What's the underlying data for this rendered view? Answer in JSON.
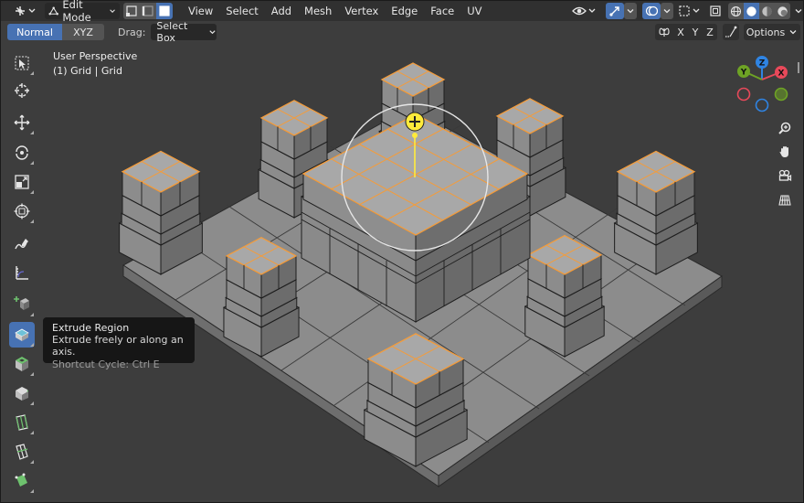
{
  "header": {
    "mode_label": "Edit Mode",
    "menu": [
      "View",
      "Select",
      "Add",
      "Mesh",
      "Vertex",
      "Edge",
      "Face",
      "UV"
    ],
    "icons": {
      "editor_type": "axis-gizmo-icon",
      "select_vertex": "vertex-select-icon",
      "select_edge": "edge-select-icon",
      "select_face": "face-select-icon",
      "visibility": "eye-icon",
      "gizmo": "gizmo-icon",
      "overlay": "overlay-icon",
      "mesh_overlay": "mesh-overlay-icon",
      "xray": "xray-icon",
      "shading": [
        "wireframe-shading-icon",
        "solid-shading-icon",
        "material-shading-icon",
        "rendered-shading-icon"
      ]
    }
  },
  "tool_settings": {
    "orientation_options": [
      "Normal",
      "XYZ"
    ],
    "orientation_selected": "Normal",
    "drag_label": "Drag:",
    "drag_value": "Select Box",
    "mirror_axes": [
      "X",
      "Y",
      "Z"
    ],
    "options_label": "Options"
  },
  "viewport": {
    "perspective": "User Perspective",
    "object_info": "(1) Grid | Grid"
  },
  "toolbar": {
    "tools": [
      {
        "name": "select-box-icon",
        "active": false
      },
      {
        "name": "cursor-icon",
        "active": false
      },
      {
        "name": "move-icon",
        "active": false
      },
      {
        "name": "rotate-icon",
        "active": false
      },
      {
        "name": "scale-icon",
        "active": false
      },
      {
        "name": "transform-icon",
        "active": false
      },
      {
        "name": "annotate-icon",
        "active": false
      },
      {
        "name": "measure-icon",
        "active": false
      },
      {
        "name": "add-cube-icon",
        "active": false
      },
      {
        "name": "extrude-region-icon",
        "active": true
      },
      {
        "name": "inset-faces-icon",
        "active": false
      },
      {
        "name": "bevel-icon",
        "active": false
      },
      {
        "name": "loop-cut-icon",
        "active": false
      },
      {
        "name": "knife-icon",
        "active": false
      },
      {
        "name": "poly-build-icon",
        "active": false
      }
    ]
  },
  "tooltip": {
    "title": "Extrude Region",
    "description": "Extrude freely or along an axis.",
    "shortcut": "Shortcut Cycle: Ctrl E"
  },
  "nav_gizmo": {
    "axes": {
      "x": "X",
      "y": "Y",
      "z": "Z"
    },
    "colors": {
      "x": "#e8495a",
      "y": "#6ea325",
      "z": "#2f84e3"
    }
  },
  "nav_buttons": [
    "zoom-icon",
    "hand-pan-icon",
    "camera-icon",
    "grid-view-icon"
  ],
  "colors": {
    "accent": "#4772b3",
    "selection": "#f39c3c",
    "background": "#3d3d3d",
    "mesh": "#9a9a9a"
  }
}
